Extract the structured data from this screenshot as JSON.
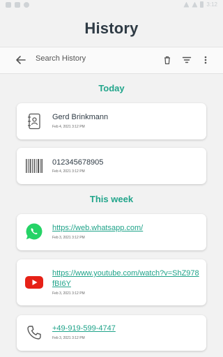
{
  "status_bar": {
    "time": "3:12"
  },
  "title": "History",
  "search": {
    "placeholder": "Search History"
  },
  "sections": {
    "today": "Today",
    "this_week": "This week"
  },
  "items": [
    {
      "type": "contact",
      "icon": "contact-icon",
      "text": "Gerd Brinkmann",
      "date": "Feb 4, 2021 3:12 PM"
    },
    {
      "type": "barcode",
      "icon": "barcode-icon",
      "text": "012345678905",
      "date": "Feb 4, 2021 3:12 PM"
    },
    {
      "type": "link",
      "icon": "whatsapp-icon",
      "text": "https://web.whatsapp.com/",
      "date": "Feb 3, 2021 3:12 PM"
    },
    {
      "type": "link",
      "icon": "youtube-icon",
      "text": "https://www.youtube.com/watch?v=ShZ978fBI6Y",
      "date": "Feb 3, 2021 3:12 PM"
    },
    {
      "type": "phone",
      "icon": "phone-icon",
      "text": "+49-919-599-4747",
      "date": "Feb 3, 2021 3:12 PM"
    }
  ],
  "colors": {
    "accent": "#22a58b",
    "title": "#2f3b45",
    "youtube": "#e62117",
    "whatsapp": "#25d366"
  }
}
